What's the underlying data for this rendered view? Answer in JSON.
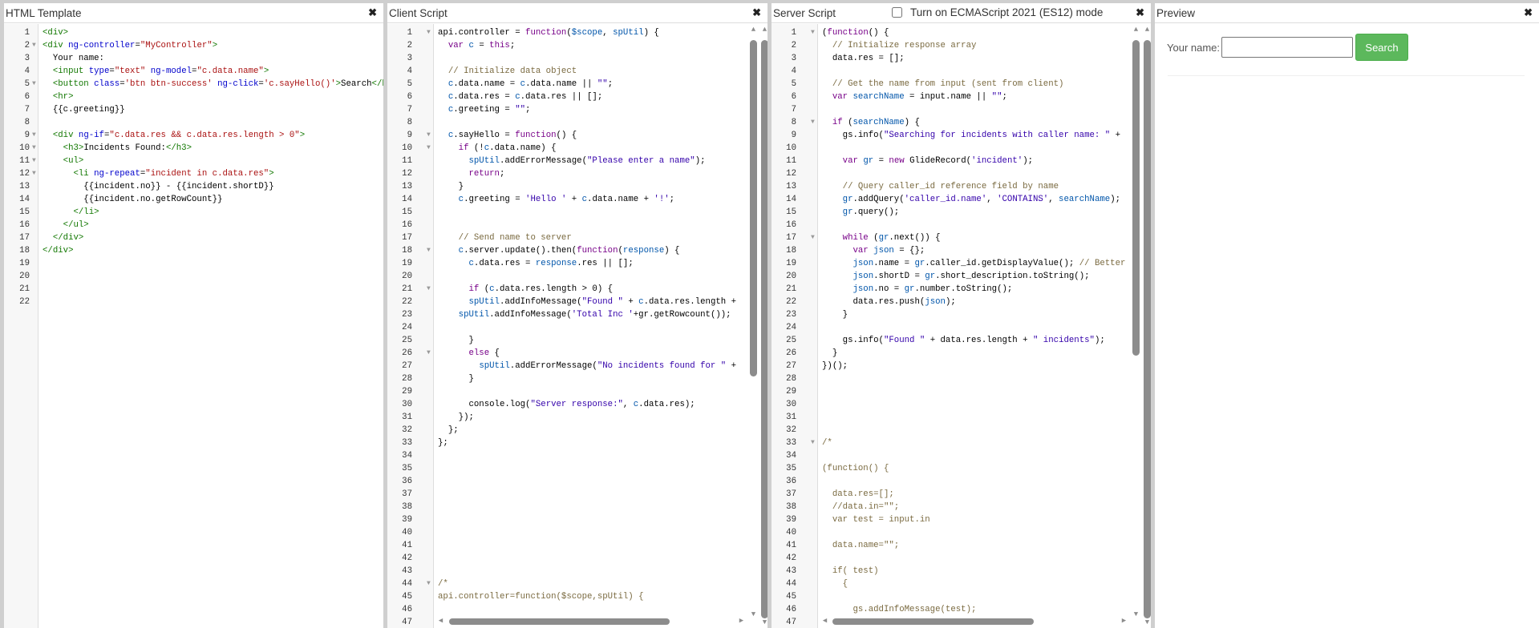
{
  "panels": {
    "html": {
      "title": "HTML Template"
    },
    "client": {
      "title": "Client Script"
    },
    "server": {
      "title": "Server Script",
      "es_mode_label": "Turn on ECMAScript 2021 (ES12) mode",
      "es_mode_checked": false
    },
    "preview": {
      "title": "Preview",
      "name_label": "Your name:",
      "name_value": "",
      "search_button": "Search"
    }
  },
  "close_icon": "✖",
  "colors": {
    "accent_button": "#5cb85c"
  },
  "html_code": {
    "total_lines": 22,
    "folds": [
      2,
      5,
      9,
      10,
      11,
      12
    ],
    "lines": [
      [
        [
          "t",
          "<div>"
        ]
      ],
      [
        [
          "t",
          "<div "
        ],
        [
          "a",
          "ng-controller"
        ],
        [
          "",
          "="
        ],
        [
          "s",
          "\"MyController\""
        ],
        [
          "t",
          ">"
        ]
      ],
      [
        [
          "",
          "  Your name:"
        ]
      ],
      [
        [
          "",
          "  "
        ],
        [
          "t",
          "<input "
        ],
        [
          "a",
          "type"
        ],
        [
          "",
          "="
        ],
        [
          "s",
          "\"text\""
        ],
        [
          "",
          " "
        ],
        [
          "a",
          "ng-model"
        ],
        [
          "",
          "="
        ],
        [
          "s",
          "\"c.data.name\""
        ],
        [
          "t",
          ">"
        ]
      ],
      [
        [
          "",
          "  "
        ],
        [
          "t",
          "<button "
        ],
        [
          "a",
          "class"
        ],
        [
          "",
          "="
        ],
        [
          "s",
          "'btn btn-success'"
        ],
        [
          "",
          " "
        ],
        [
          "a",
          "ng-click"
        ],
        [
          "",
          "="
        ],
        [
          "s",
          "'c.sayHello()'"
        ],
        [
          "t",
          ">"
        ],
        [
          "",
          "Search"
        ],
        [
          "t",
          "</button>"
        ]
      ],
      [
        [
          "",
          "  "
        ],
        [
          "t",
          "<hr>"
        ]
      ],
      [
        [
          "",
          "  {{c.greeting}}"
        ]
      ],
      [],
      [
        [
          "",
          "  "
        ],
        [
          "t",
          "<div "
        ],
        [
          "a",
          "ng-if"
        ],
        [
          "",
          "="
        ],
        [
          "s",
          "\"c.data.res && c.data.res.length > 0\""
        ],
        [
          "t",
          ">"
        ]
      ],
      [
        [
          "",
          "    "
        ],
        [
          "t",
          "<h3>"
        ],
        [
          "",
          "Incidents Found:"
        ],
        [
          "t",
          "</h3>"
        ]
      ],
      [
        [
          "",
          "    "
        ],
        [
          "t",
          "<ul>"
        ]
      ],
      [
        [
          "",
          "      "
        ],
        [
          "t",
          "<li "
        ],
        [
          "a",
          "ng-repeat"
        ],
        [
          "",
          "="
        ],
        [
          "s",
          "\"incident in c.data.res\""
        ],
        [
          "t",
          ">"
        ]
      ],
      [
        [
          "",
          "        {{incident.no}} - {{incident.shortD}}"
        ]
      ],
      [
        [
          "",
          "        {{incident.no.getRowCount}}"
        ]
      ],
      [
        [
          "",
          "      "
        ],
        [
          "t",
          "</li>"
        ]
      ],
      [
        [
          "",
          "    "
        ],
        [
          "t",
          "</ul>"
        ]
      ],
      [
        [
          "",
          "  "
        ],
        [
          "t",
          "</div>"
        ]
      ],
      [
        [
          "t",
          "</div>"
        ]
      ]
    ]
  },
  "client_code": {
    "total_lines": 47,
    "folds": [
      1,
      9,
      10,
      18,
      21,
      26,
      44
    ],
    "lines": [
      [
        [
          "",
          "api.controller = "
        ],
        [
          "k",
          "function"
        ],
        [
          "",
          "("
        ],
        [
          "v",
          "$scope"
        ],
        [
          "",
          ", "
        ],
        [
          "v",
          "spUtil"
        ],
        [
          "",
          ") {"
        ]
      ],
      [
        [
          "",
          "  "
        ],
        [
          "k",
          "var"
        ],
        [
          "",
          " "
        ],
        [
          "v",
          "c"
        ],
        [
          "",
          " = "
        ],
        [
          "k",
          "this"
        ],
        [
          "",
          ";"
        ]
      ],
      [],
      [
        [
          "",
          "  "
        ],
        [
          "c",
          "// Initialize data object"
        ]
      ],
      [
        [
          "",
          "  "
        ],
        [
          "v",
          "c"
        ],
        [
          "",
          ".data.name = "
        ],
        [
          "v",
          "c"
        ],
        [
          "",
          ".data.name || "
        ],
        [
          "js",
          "\"\""
        ],
        [
          "",
          ";"
        ]
      ],
      [
        [
          "",
          "  "
        ],
        [
          "v",
          "c"
        ],
        [
          "",
          ".data.res = "
        ],
        [
          "v",
          "c"
        ],
        [
          "",
          ".data.res || [];"
        ]
      ],
      [
        [
          "",
          "  "
        ],
        [
          "v",
          "c"
        ],
        [
          "",
          ".greeting = "
        ],
        [
          "js",
          "\"\""
        ],
        [
          "",
          ";"
        ]
      ],
      [],
      [
        [
          "",
          "  "
        ],
        [
          "v",
          "c"
        ],
        [
          "",
          ".sayHello = "
        ],
        [
          "k",
          "function"
        ],
        [
          "",
          "() {"
        ]
      ],
      [
        [
          "",
          "    "
        ],
        [
          "k",
          "if"
        ],
        [
          "",
          " (!"
        ],
        [
          "v",
          "c"
        ],
        [
          "",
          ".data.name) {"
        ]
      ],
      [
        [
          "",
          "      "
        ],
        [
          "v",
          "spUtil"
        ],
        [
          "",
          ".addErrorMessage("
        ],
        [
          "js",
          "\"Please enter a name\""
        ],
        [
          "",
          ");"
        ]
      ],
      [
        [
          "",
          "      "
        ],
        [
          "k",
          "return"
        ],
        [
          "",
          ";"
        ]
      ],
      [
        [
          "",
          "    }"
        ]
      ],
      [
        [
          "",
          "    "
        ],
        [
          "v",
          "c"
        ],
        [
          "",
          ".greeting = "
        ],
        [
          "js",
          "'Hello '"
        ],
        [
          "",
          " + "
        ],
        [
          "v",
          "c"
        ],
        [
          "",
          ".data.name + "
        ],
        [
          "js",
          "'!'"
        ],
        [
          "",
          ";"
        ]
      ],
      [],
      [],
      [
        [
          "",
          "    "
        ],
        [
          "c",
          "// Send name to server"
        ]
      ],
      [
        [
          "",
          "    "
        ],
        [
          "v",
          "c"
        ],
        [
          "",
          ".server.update().then("
        ],
        [
          "k",
          "function"
        ],
        [
          "",
          "("
        ],
        [
          "v",
          "response"
        ],
        [
          "",
          ") {"
        ]
      ],
      [
        [
          "",
          "      "
        ],
        [
          "v",
          "c"
        ],
        [
          "",
          ".data.res = "
        ],
        [
          "v",
          "response"
        ],
        [
          "",
          ".res || [];"
        ]
      ],
      [],
      [
        [
          "",
          "      "
        ],
        [
          "k",
          "if"
        ],
        [
          "",
          " ("
        ],
        [
          "v",
          "c"
        ],
        [
          "",
          ".data.res.length > 0) {"
        ]
      ],
      [
        [
          "",
          "      "
        ],
        [
          "v",
          "spUtil"
        ],
        [
          "",
          ".addInfoMessage("
        ],
        [
          "js",
          "\"Found \""
        ],
        [
          "",
          " + "
        ],
        [
          "v",
          "c"
        ],
        [
          "",
          ".data.res.length + "
        ]
      ],
      [
        [
          "",
          "    "
        ],
        [
          "v",
          "spUtil"
        ],
        [
          "",
          ".addInfoMessage("
        ],
        [
          "js",
          "'Total Inc '"
        ],
        [
          "",
          "+gr.getRowcount());"
        ]
      ],
      [],
      [
        [
          "",
          "      }"
        ]
      ],
      [
        [
          "",
          "      "
        ],
        [
          "k",
          "else"
        ],
        [
          "",
          " {"
        ]
      ],
      [
        [
          "",
          "        "
        ],
        [
          "v",
          "spUtil"
        ],
        [
          "",
          ".addErrorMessage("
        ],
        [
          "js",
          "\"No incidents found for \""
        ],
        [
          "",
          " + "
        ]
      ],
      [
        [
          "",
          "      }"
        ]
      ],
      [],
      [
        [
          "",
          "      console.log("
        ],
        [
          "js",
          "\"Server response:\""
        ],
        [
          "",
          ", "
        ],
        [
          "v",
          "c"
        ],
        [
          "",
          ".data.res);"
        ]
      ],
      [
        [
          "",
          "    });"
        ]
      ],
      [
        [
          "",
          "  };"
        ]
      ],
      [
        [
          "",
          "};"
        ]
      ],
      [],
      [],
      [],
      [],
      [],
      [],
      [],
      [],
      [],
      [],
      [
        [
          "c",
          "/*"
        ]
      ],
      [
        [
          "c",
          "api.controller=function($scope,spUtil) {"
        ]
      ],
      [],
      []
    ]
  },
  "server_code": {
    "total_lines": 47,
    "folds": [
      1,
      8,
      17,
      33
    ],
    "lines": [
      [
        [
          "",
          "("
        ],
        [
          "k",
          "function"
        ],
        [
          "",
          "() {"
        ]
      ],
      [
        [
          "",
          "  "
        ],
        [
          "c",
          "// Initialize response array"
        ]
      ],
      [
        [
          "",
          "  data.res = [];"
        ]
      ],
      [],
      [
        [
          "",
          "  "
        ],
        [
          "c",
          "// Get the name from input (sent from client)"
        ]
      ],
      [
        [
          "",
          "  "
        ],
        [
          "k",
          "var"
        ],
        [
          "",
          " "
        ],
        [
          "v",
          "searchName"
        ],
        [
          "",
          " = input.name || "
        ],
        [
          "js",
          "\"\""
        ],
        [
          "",
          ";"
        ]
      ],
      [],
      [
        [
          "",
          "  "
        ],
        [
          "k",
          "if"
        ],
        [
          "",
          " ("
        ],
        [
          "v",
          "searchName"
        ],
        [
          "",
          ") {"
        ]
      ],
      [
        [
          "",
          "    gs.info("
        ],
        [
          "js",
          "\"Searching for incidents with caller name: \""
        ],
        [
          "",
          " + "
        ]
      ],
      [],
      [
        [
          "",
          "    "
        ],
        [
          "k",
          "var"
        ],
        [
          "",
          " "
        ],
        [
          "v",
          "gr"
        ],
        [
          "",
          " = "
        ],
        [
          "k",
          "new"
        ],
        [
          "",
          " GlideRecord("
        ],
        [
          "js",
          "'incident'"
        ],
        [
          "",
          ");"
        ]
      ],
      [],
      [
        [
          "",
          "    "
        ],
        [
          "c",
          "// Query caller_id reference field by name"
        ]
      ],
      [
        [
          "",
          "    "
        ],
        [
          "v",
          "gr"
        ],
        [
          "",
          ".addQuery("
        ],
        [
          "js",
          "'caller_id.name'"
        ],
        [
          "",
          ", "
        ],
        [
          "js",
          "'CONTAINS'"
        ],
        [
          "",
          ", "
        ],
        [
          "v",
          "searchName"
        ],
        [
          "",
          ");"
        ]
      ],
      [
        [
          "",
          "    "
        ],
        [
          "v",
          "gr"
        ],
        [
          "",
          ".query();"
        ]
      ],
      [],
      [
        [
          "",
          "    "
        ],
        [
          "k",
          "while"
        ],
        [
          "",
          " ("
        ],
        [
          "v",
          "gr"
        ],
        [
          "",
          ".next()) {"
        ]
      ],
      [
        [
          "",
          "      "
        ],
        [
          "k",
          "var"
        ],
        [
          "",
          " "
        ],
        [
          "v",
          "json"
        ],
        [
          "",
          " = {};"
        ]
      ],
      [
        [
          "",
          "      "
        ],
        [
          "v",
          "json"
        ],
        [
          "",
          ".name = "
        ],
        [
          "v",
          "gr"
        ],
        [
          "",
          ".caller_id.getDisplayValue(); "
        ],
        [
          "c",
          "// Better"
        ]
      ],
      [
        [
          "",
          "      "
        ],
        [
          "v",
          "json"
        ],
        [
          "",
          ".shortD = "
        ],
        [
          "v",
          "gr"
        ],
        [
          "",
          ".short_description.toString();"
        ]
      ],
      [
        [
          "",
          "      "
        ],
        [
          "v",
          "json"
        ],
        [
          "",
          ".no = "
        ],
        [
          "v",
          "gr"
        ],
        [
          "",
          ".number.toString();"
        ]
      ],
      [
        [
          "",
          "      data.res.push("
        ],
        [
          "v",
          "json"
        ],
        [
          "",
          ");"
        ]
      ],
      [
        [
          "",
          "    }"
        ]
      ],
      [],
      [
        [
          "",
          "    gs.info("
        ],
        [
          "js",
          "\"Found \""
        ],
        [
          "",
          " + data.res.length + "
        ],
        [
          "js",
          "\" incidents\""
        ],
        [
          "",
          ");"
        ]
      ],
      [
        [
          "",
          "  }"
        ]
      ],
      [
        [
          "",
          "})();"
        ]
      ],
      [],
      [],
      [],
      [],
      [],
      [
        [
          "c",
          "/*"
        ]
      ],
      [],
      [
        [
          "c",
          "(function() {"
        ]
      ],
      [],
      [
        [
          "c",
          "  data.res=[];"
        ]
      ],
      [
        [
          "c",
          "  //data.in=\"\";"
        ]
      ],
      [
        [
          "c",
          "  var test = input.in"
        ]
      ],
      [],
      [
        [
          "c",
          "  data.name=\"\";"
        ]
      ],
      [],
      [
        [
          "c",
          "  if( test)"
        ]
      ],
      [
        [
          "c",
          "    {"
        ]
      ],
      [],
      [
        [
          "c",
          "      gs.addInfoMessage(test);"
        ]
      ],
      []
    ]
  }
}
